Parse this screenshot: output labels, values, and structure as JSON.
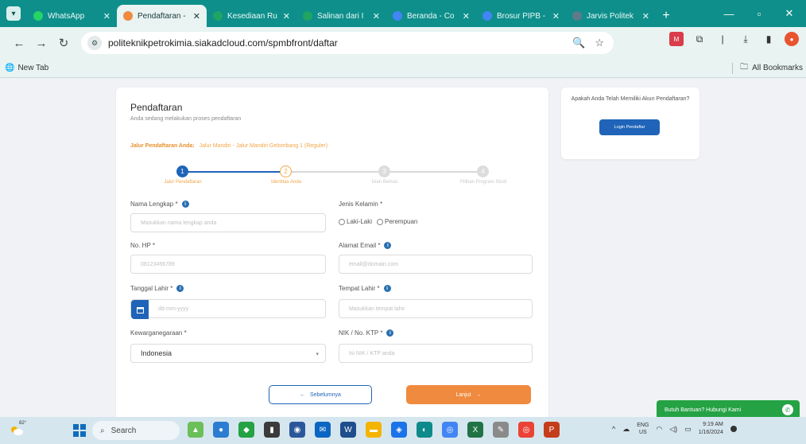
{
  "browser": {
    "tabs": [
      {
        "label": "WhatsApp",
        "favicon_color": "#25d366"
      },
      {
        "label": "Pendaftaran -",
        "favicon_color": "#f08a3e"
      },
      {
        "label": "Kesediaan Ru",
        "favicon_color": "#1fa463"
      },
      {
        "label": "Salinan dari I",
        "favicon_color": "#1fa463"
      },
      {
        "label": "Beranda - Co",
        "favicon_color": "#4285f4"
      },
      {
        "label": "Brosur PIPB -",
        "favicon_color": "#4285f4"
      },
      {
        "label": "Jarvis Politek",
        "favicon_color": "#5f7a8a"
      }
    ],
    "active_tab_index": 1,
    "url": "politeknikpetrokimia.siakadcloud.com/spmbfront/daftar",
    "bookmarks": {
      "new_tab": "New Tab",
      "all": "All Bookmarks"
    }
  },
  "form": {
    "title": "Pendaftaran",
    "subtitle": "Anda sedang melakukan proses pendaftaran",
    "jalur_label": "Jalur Pendaftaran Anda:",
    "jalur_value": "Jalur Mandiri - Jalur Mandiri Gelombang 1 (Reguler)",
    "steps": [
      {
        "number": "1",
        "label": "Jalur Pendaftaran",
        "state": "done"
      },
      {
        "number": "2",
        "label": "Identitas Anda",
        "state": "active"
      },
      {
        "number": "3",
        "label": "Isian Berkas",
        "state": "pending"
      },
      {
        "number": "4",
        "label": "Pilihan Program Studi",
        "state": "pending"
      }
    ],
    "fields": {
      "nama": {
        "label": "Nama Lengkap *",
        "placeholder": "Masukkan nama lengkap anda"
      },
      "jenis_kelamin": {
        "label": "Jenis Kelamin *",
        "options": [
          "Laki-Laki",
          "Perempuan"
        ]
      },
      "hp": {
        "label": "No. HP *",
        "placeholder": "08123456789"
      },
      "email": {
        "label": "Alamat Email *",
        "placeholder": "email@domain.com"
      },
      "tgl_lahir": {
        "label": "Tanggal Lahir *",
        "placeholder": "dd-mm-yyyy"
      },
      "tempat_lahir": {
        "label": "Tempat Lahir *",
        "placeholder": "Masukkan tempat lahir"
      },
      "kewarganegaraan": {
        "label": "Kewarganegaraan *",
        "value": "Indonesia"
      },
      "nik": {
        "label": "NIK / No. KTP *",
        "placeholder": "Isi NIK / KTP anda"
      }
    },
    "prev_label": "Sebelumnya",
    "next_label": "Lanjut"
  },
  "login_card": {
    "question": "Apakah Anda Telah Memiliki Akun Pendaftaran?",
    "button": "Login Pendaftar"
  },
  "help_label": "Butuh Bantuan? Hubungi Kami",
  "taskbar": {
    "temp": "82°",
    "search": "Search",
    "lang_top": "ENG",
    "lang_bottom": "US",
    "time": "9:19 AM",
    "date": "1/16/2024"
  },
  "colors": {
    "primary": "#1f64b8",
    "accent": "#f08a3e",
    "chrome": "#0e8f8b"
  }
}
